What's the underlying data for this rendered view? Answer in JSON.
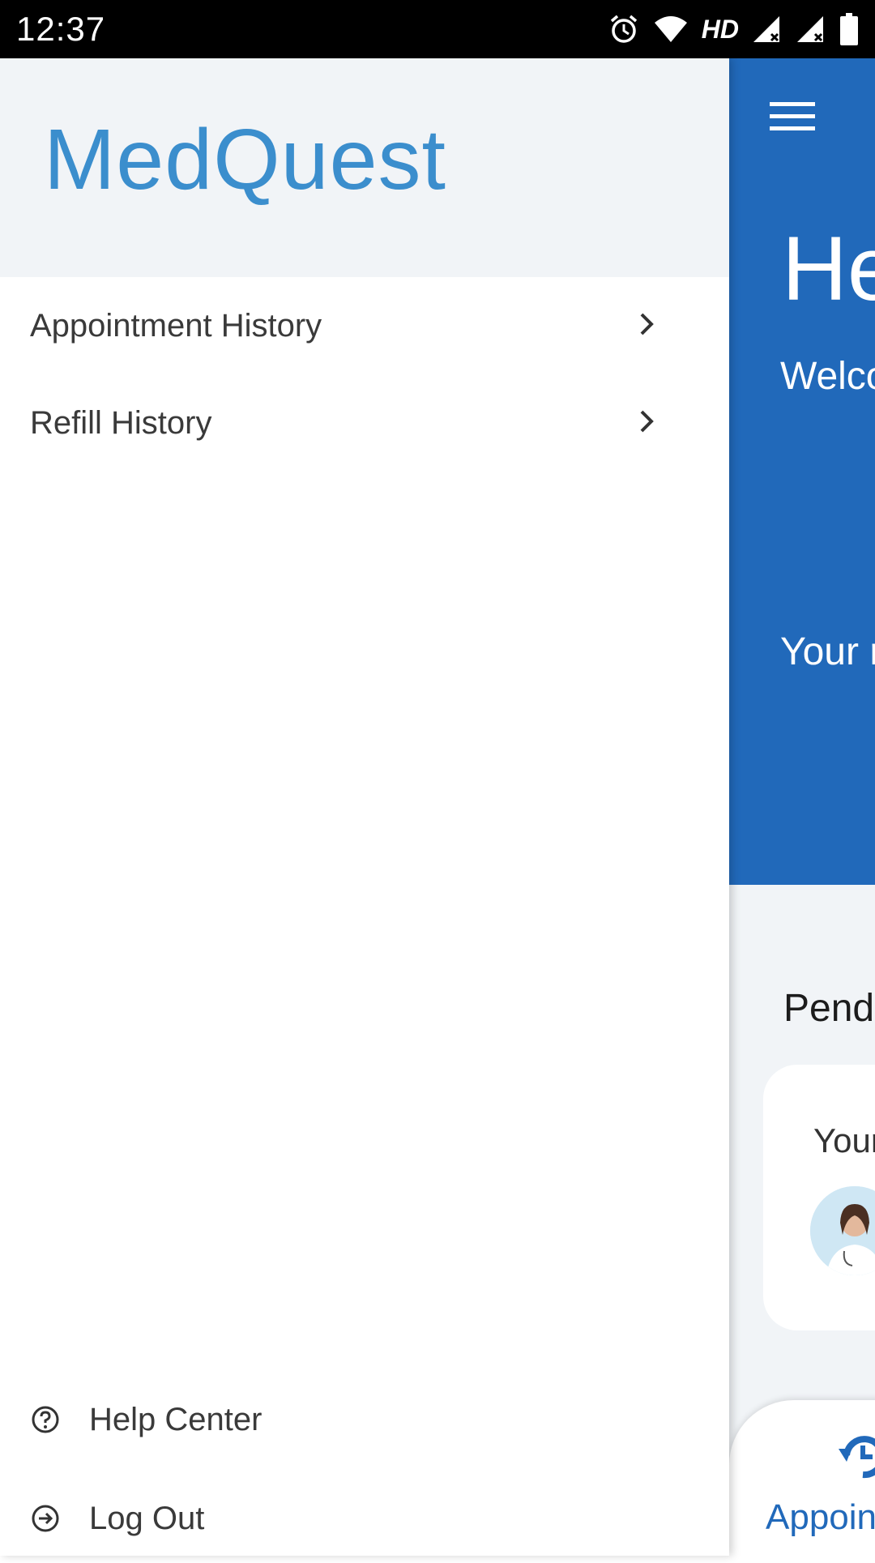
{
  "status_bar": {
    "time": "12:37",
    "hd": "HD",
    "icons": [
      "alarm-icon",
      "wifi-icon",
      "signal-icon",
      "signal-icon",
      "battery-icon"
    ]
  },
  "drawer": {
    "logo": "MedQuest",
    "items": [
      {
        "label": "Appointment History",
        "icon": "chevron-right-icon"
      },
      {
        "label": "Refill History",
        "icon": "chevron-right-icon"
      }
    ],
    "footer": [
      {
        "label": "Help Center",
        "icon": "help-circle-icon"
      },
      {
        "label": "Log Out",
        "icon": "logout-arrow-icon"
      }
    ]
  },
  "main": {
    "greeting": "He",
    "welcome": "Welco",
    "your_text": "Your r",
    "pending_title": "Pend",
    "card_text": "Your",
    "bottom_nav_label": "Appoin"
  },
  "colors": {
    "brand_blue": "#2169ba",
    "logo_blue": "#3b8ecd",
    "header_bg": "#f1f4f7"
  }
}
